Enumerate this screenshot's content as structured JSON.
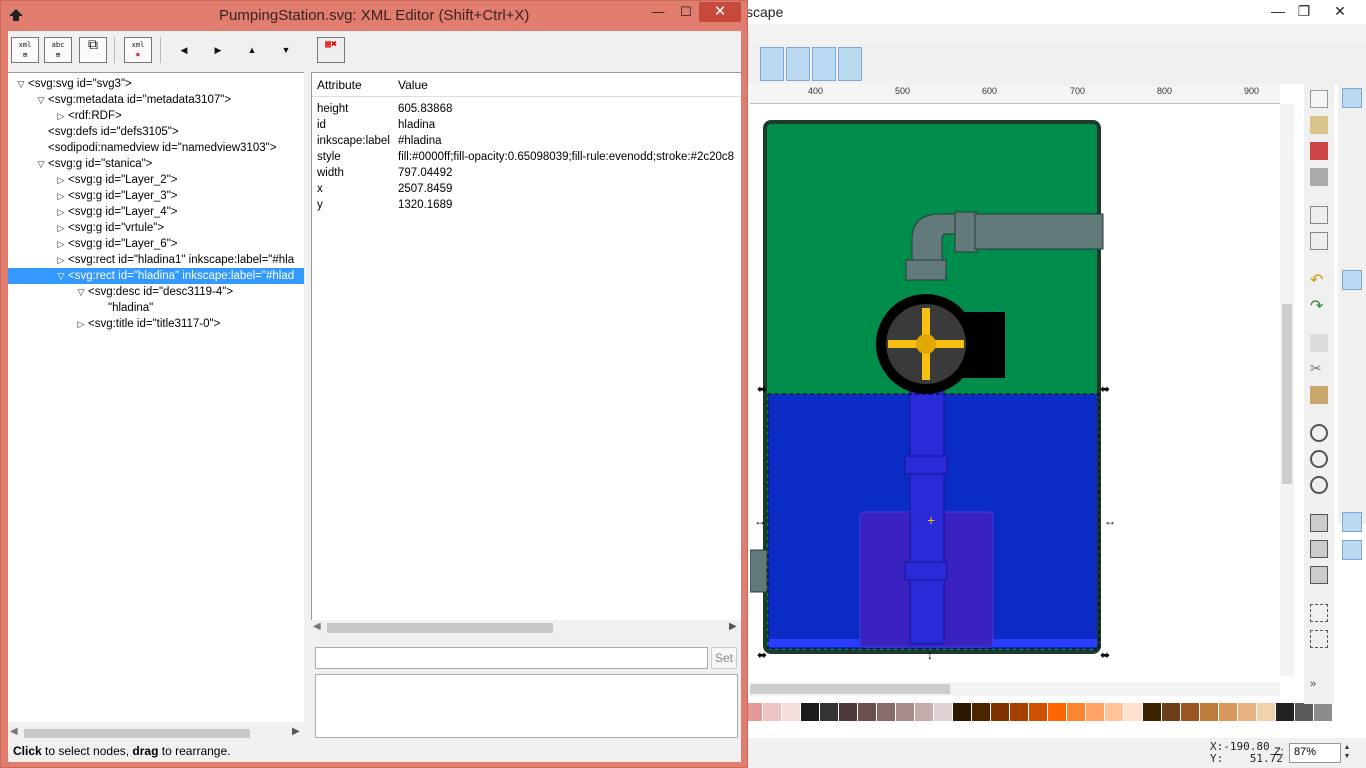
{
  "main_window": {
    "title_fragment": "scape",
    "ruler_labels": [
      "400",
      "500",
      "600",
      "700",
      "800",
      "900"
    ],
    "coords": {
      "x_label": "X:",
      "x": "-190.80",
      "y_label": "Y:",
      "y": "51.72"
    },
    "zoom_label": "Z:",
    "zoom_value": "87%",
    "palette": [
      "#e59a9a",
      "#eec3c3",
      "#f5dede",
      "#1a1a1a",
      "#333333",
      "#4d3939",
      "#6b4f4f",
      "#8a6b6b",
      "#a88c8c",
      "#c4adad",
      "#e0d2d2",
      "#2b1a00",
      "#4d2600",
      "#803300",
      "#a64000",
      "#cc5200",
      "#ff6600",
      "#ff8533",
      "#ffa366",
      "#ffc299",
      "#ffe0cc",
      "#3d2200",
      "#6e3d1a",
      "#995522",
      "#bf7a3d",
      "#d9995c",
      "#e6b380",
      "#f2d1ad",
      "#222222",
      "#5a5a5a",
      "#8c8c8c"
    ]
  },
  "xml_editor": {
    "title": "PumpingStation.svg: XML Editor (Shift+Ctrl+X)",
    "window_buttons": {
      "minimize": "—",
      "maximize": "☐",
      "close": "✕"
    },
    "toolbar": [
      {
        "name": "new-element-node-button",
        "label": "xml"
      },
      {
        "name": "new-text-node-button",
        "label": "abc"
      },
      {
        "name": "duplicate-node-button",
        "label": "⧉"
      },
      {
        "name": "delete-node-button",
        "label": "xml"
      }
    ],
    "arrows": {
      "unindent": "◀",
      "indent": "▶",
      "raise": "▲",
      "lower": "▼"
    },
    "tree": [
      {
        "depth": 0,
        "expander": "▽",
        "text": "<svg:svg id=\"svg3\">"
      },
      {
        "depth": 1,
        "expander": "▽",
        "text": "<svg:metadata id=\"metadata3107\">"
      },
      {
        "depth": 2,
        "expander": "▷",
        "text": "<rdf:RDF>"
      },
      {
        "depth": 1,
        "expander": "",
        "text": "<svg:defs id=\"defs3105\">"
      },
      {
        "depth": 1,
        "expander": "",
        "text": "<sodipodi:namedview id=\"namedview3103\">"
      },
      {
        "depth": 1,
        "expander": "▽",
        "text": "<svg:g id=\"stanica\">"
      },
      {
        "depth": 2,
        "expander": "▷",
        "text": "<svg:g id=\"Layer_2\">"
      },
      {
        "depth": 2,
        "expander": "▷",
        "text": "<svg:g id=\"Layer_3\">"
      },
      {
        "depth": 2,
        "expander": "▷",
        "text": "<svg:g id=\"Layer_4\">"
      },
      {
        "depth": 2,
        "expander": "▷",
        "text": "<svg:g id=\"vrtule\">"
      },
      {
        "depth": 2,
        "expander": "▷",
        "text": "<svg:g id=\"Layer_6\">"
      },
      {
        "depth": 2,
        "expander": "▷",
        "text": "<svg:rect id=\"hladina1\" inkscape:label=\"#hla"
      },
      {
        "depth": 2,
        "expander": "▽",
        "text": "<svg:rect id=\"hladina\" inkscape:label=\"#hlad",
        "selected": true
      },
      {
        "depth": 3,
        "expander": "▽",
        "text": "<svg:desc id=\"desc3119-4\">"
      },
      {
        "depth": 4,
        "expander": "",
        "text": "\"hladina\""
      },
      {
        "depth": 3,
        "expander": "▷",
        "text": "<svg:title id=\"title3117-0\">"
      }
    ],
    "attributes_header": {
      "name": "Attribute",
      "value": "Value"
    },
    "attributes": [
      {
        "name": "height",
        "value": "605.83868"
      },
      {
        "name": "id",
        "value": "hladina"
      },
      {
        "name": "inkscape:label",
        "value": "#hladina"
      },
      {
        "name": "style",
        "value": "fill:#0000ff;fill-opacity:0.65098039;fill-rule:evenodd;stroke:#2c20c8"
      },
      {
        "name": "width",
        "value": "797.04492"
      },
      {
        "name": "x",
        "value": "2507.8459"
      },
      {
        "name": "y",
        "value": "1320.1689"
      }
    ],
    "set_button": "Set",
    "status": {
      "click": "Click",
      "rest1": " to select nodes, ",
      "drag": "drag",
      "rest2": " to rearrange."
    }
  },
  "colors": {
    "dialog_border": "#e17d6f",
    "selection": "#3399ff",
    "tank_green": "#008c4a",
    "water_blue": "#0a2cc4"
  }
}
